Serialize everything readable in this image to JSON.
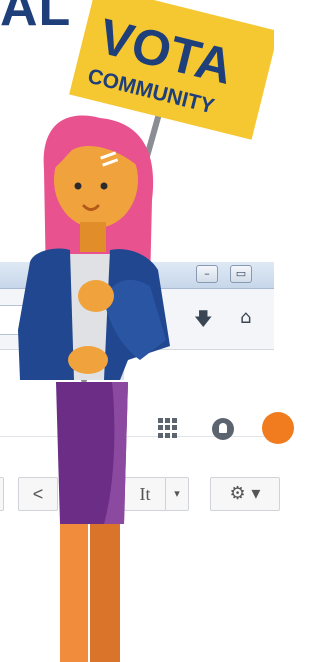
{
  "header": {
    "title_fragment": "AL"
  },
  "sign": {
    "line1": "VOTA",
    "line2": "COMMUNITY"
  },
  "browser": {
    "window_buttons": {
      "minimize": "–",
      "maximize": "▭"
    },
    "nav_icons": [
      "star-icon",
      "download-icon",
      "home-icon"
    ],
    "toolbar": {
      "back_label": "<",
      "language_label": "It",
      "language_caret": "▾",
      "settings_label": "⚙ ▾"
    }
  },
  "colors": {
    "title_blue": "#1f3f7a",
    "sign_yellow": "#f5c731",
    "hair_pink": "#e8528f",
    "jacket_blue": "#20478f",
    "skirt_purple": "#6c2d86",
    "skin": "#f0a23c",
    "avatar_orange": "#f07c1f"
  }
}
